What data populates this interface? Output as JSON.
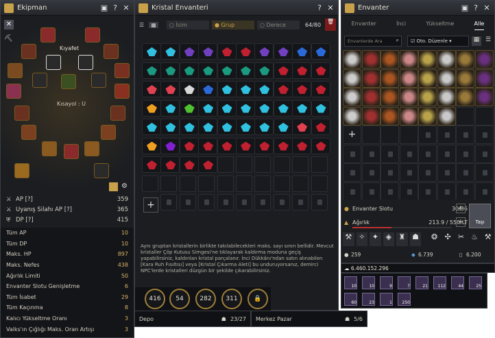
{
  "equip": {
    "title": "Ekipman",
    "kiyafet": "Kıyafet",
    "kisayol": "Kısayol : U",
    "stats": [
      {
        "label": "AP [?]",
        "value": "359"
      },
      {
        "label": "Uyanış Silahı AP [?]",
        "value": "365"
      },
      {
        "label": "DP [?]",
        "value": "415"
      }
    ],
    "details": [
      {
        "label": "Tüm AP",
        "value": "10"
      },
      {
        "label": "Tüm DP",
        "value": "10"
      },
      {
        "label": "Maks. HP",
        "value": "897"
      },
      {
        "label": "Maks. Nefes",
        "value": "438"
      },
      {
        "label": "Ağırlık Limiti",
        "value": "50"
      },
      {
        "label": "Envanter Slotu Genişletme",
        "value": "6"
      },
      {
        "label": "Tüm İsabet",
        "value": "29"
      },
      {
        "label": "Tüm Kaçınma",
        "value": "8"
      },
      {
        "label": "Kalıcı Yükseltme Oranı",
        "value": "3"
      },
      {
        "label": "Valks'ın Çığlığı Maks. Oran Artışı",
        "value": "3"
      }
    ]
  },
  "crystal": {
    "title": "Kristal Envanteri",
    "tabs": [
      "İsim",
      "Grup",
      "Derece"
    ],
    "count": "64/80",
    "info": "Aynı gruptan kristallerin birlikte takılabilecekleri maks. sayı sınırı bellidir. Mevcut kristaller Çöp Kutusu Simgesi'ne tıklayarak kaldırma moduna geçiş yapabilirsiniz, kaldırılan kristal parçalanır. İnci Dükkânı'ndan satın alınabilen [Kara Ruh Fısıltısı] veya [Kristal Çıkarma Aleti] bu unduruyorsanız, demirci NPC'lerde kristalleri düzgün bir şekilde çıkarabilirsiniz.",
    "bubbles": [
      "416",
      "54",
      "282",
      "311"
    ]
  },
  "storage": {
    "depo": "Depo",
    "depo_count": "23/27",
    "pazar": "Merkez Pazar",
    "pazar_count": "5/6"
  },
  "inventory": {
    "title": "Envanter",
    "tabs": [
      "Envanter",
      "İnci",
      "Yükseltme",
      "Alle"
    ],
    "search_placeholder": "Envanterde Ara",
    "auto_sort": "Oto. Düzenle",
    "slots_label": "Envanter Slotu",
    "slots_value": "30/36",
    "weight_label": "Ağırlık",
    "weight_value": "213.9 / 550 LT",
    "move": "Taşı",
    "silver": "259",
    "currency2": "6.739",
    "currency3": "6.200",
    "money": "6.460.152.296",
    "mats": [
      "10",
      "10",
      "9",
      "7",
      "21",
      "112",
      "44",
      "25",
      "60",
      "23",
      "1",
      "250"
    ]
  },
  "colors": {
    "accent": "#c9a14a",
    "red": "#b0202a",
    "blue": "#2a9ad8",
    "green": "#20a070"
  }
}
